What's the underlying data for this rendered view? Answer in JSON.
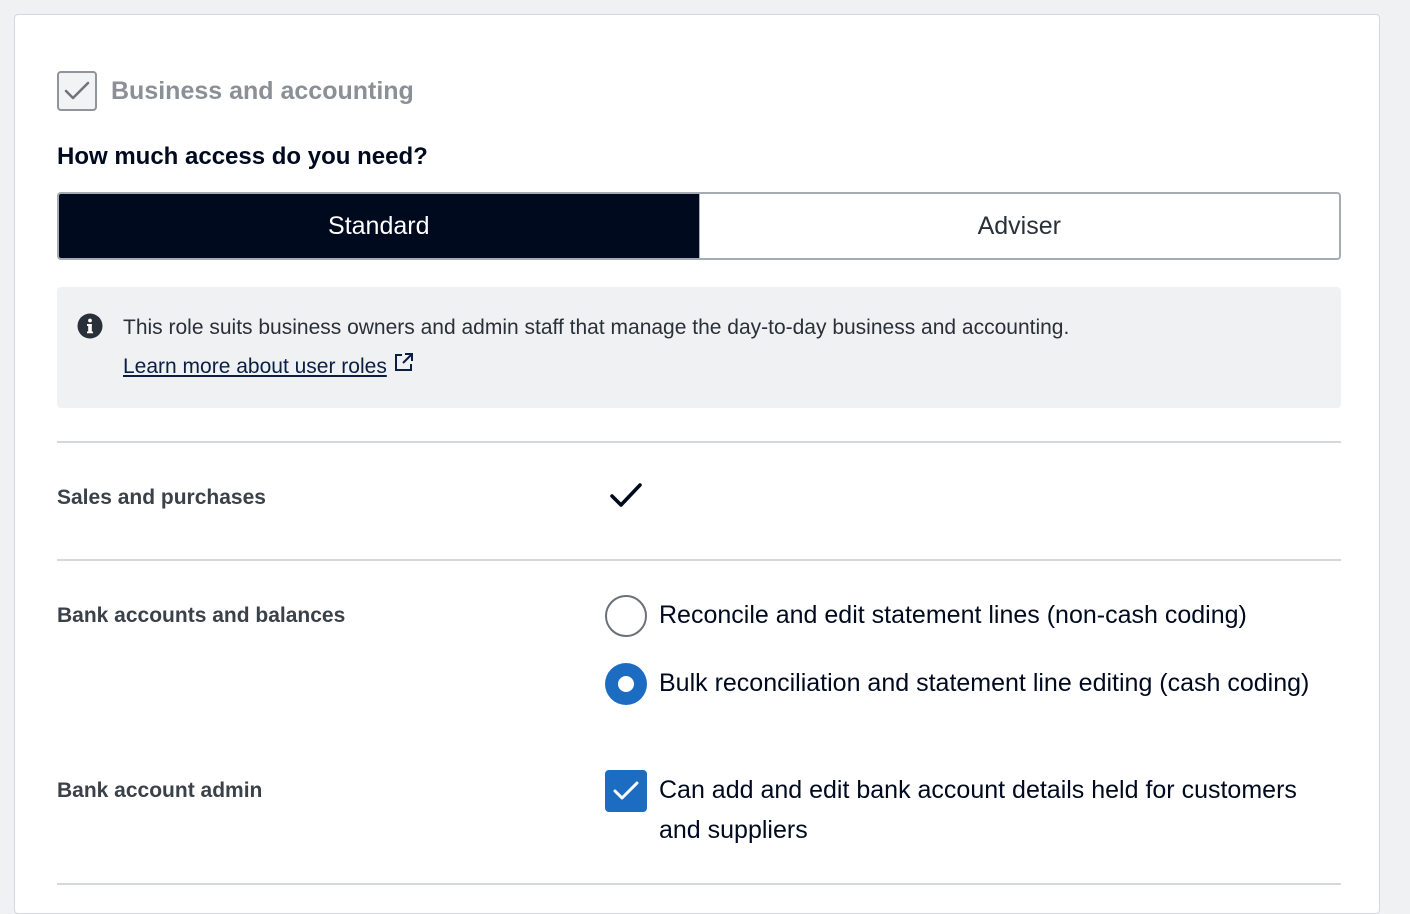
{
  "section": {
    "title": "Business and accounting",
    "checked": true
  },
  "access": {
    "question": "How much access do you need?",
    "options": [
      {
        "label": "Standard",
        "selected": true
      },
      {
        "label": "Adviser",
        "selected": false
      }
    ]
  },
  "info": {
    "icon": "info-circle-icon",
    "text": "This role suits business owners and admin staff that manage the day-to-day business and accounting.",
    "link_label": "Learn more about user roles",
    "link_icon": "external-link-icon"
  },
  "rows": {
    "sales": {
      "label": "Sales and purchases",
      "icon": "checkmark-icon"
    },
    "bank": {
      "label": "Bank accounts and balances",
      "options": [
        {
          "label": "Reconcile and edit statement lines (non-cash coding)",
          "selected": false
        },
        {
          "label": "Bulk reconciliation and statement line editing (cash coding)",
          "selected": true
        }
      ]
    },
    "admin": {
      "label": "Bank account admin",
      "option_label": "Can add and edit bank account details held for customers and suppliers",
      "checked": true
    }
  },
  "colors": {
    "active_segment": "#000a1e",
    "accent": "#1c6cc2",
    "info_bg": "#eff1f3"
  }
}
